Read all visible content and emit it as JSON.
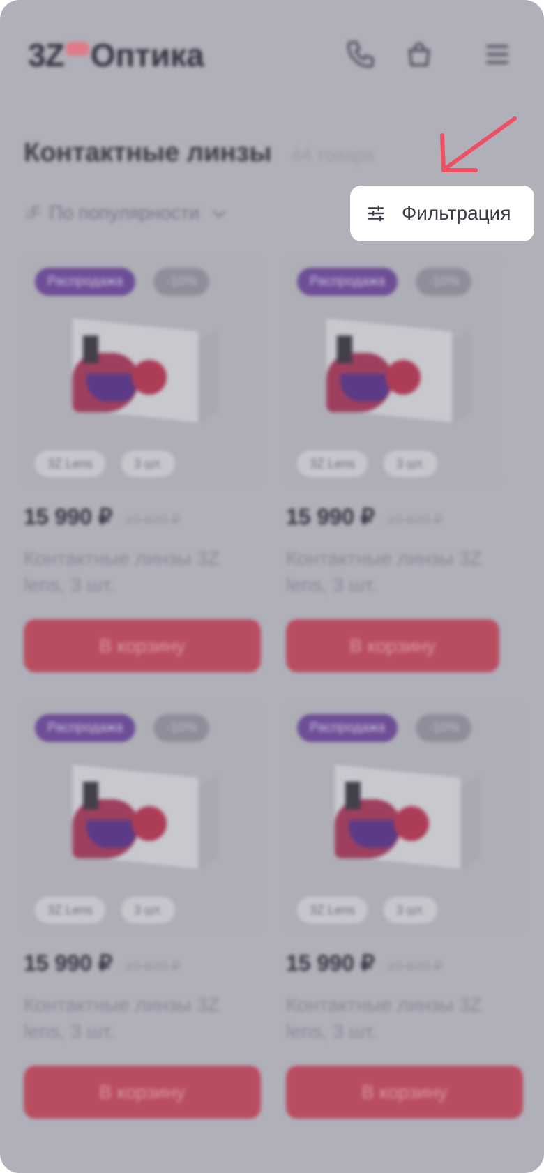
{
  "header": {
    "logo_mark": "3Z",
    "logo_name": "Оптика",
    "icons": [
      "phone-icon",
      "bag-icon",
      "menu-icon"
    ]
  },
  "catalog": {
    "title": "Контактные линзы",
    "count": "44 товара",
    "sort_label": "По популярности",
    "filter_label": "Фильтрация"
  },
  "products": [
    {
      "tag_sale": "Распродажа",
      "tag_discount": "-10%",
      "chip_brand": "3Z Lens",
      "chip_qty": "3 шт.",
      "price": "15 990 ₽",
      "old_price": "19 620 ₽",
      "name": "Контактные линзы 3Z lens, 3 шт.",
      "button": "В корзину"
    },
    {
      "tag_sale": "Распродажа",
      "tag_discount": "-10%",
      "chip_brand": "3Z Lens",
      "chip_qty": "3 шт.",
      "price": "15 990 ₽",
      "old_price": "19 620 ₽",
      "name": "Контактные линзы 3Z lens, 3 шт.",
      "button": "В корзину"
    },
    {
      "tag_sale": "Распродажа",
      "tag_discount": "-10%",
      "chip_brand": "3Z Lens",
      "chip_qty": "3 шт.",
      "price": "15 990 ₽",
      "old_price": "19 620 ₽",
      "name": "Контактные линзы 3Z lens, 3 шт.",
      "button": "В корзину"
    },
    {
      "tag_sale": "Распродажа",
      "tag_discount": "-10%",
      "chip_brand": "3Z Lens",
      "chip_qty": "3 шт.",
      "price": "15 990 ₽",
      "old_price": "19 620 ₽",
      "name": "Контактные линзы 3Z lens, 3 шт.",
      "button": "В корзину"
    }
  ],
  "colors": {
    "overlay": "#b0b0ba",
    "accent": "#e94b5f",
    "sale_tag": "#6e4e97",
    "highlight": "#ffffff"
  }
}
